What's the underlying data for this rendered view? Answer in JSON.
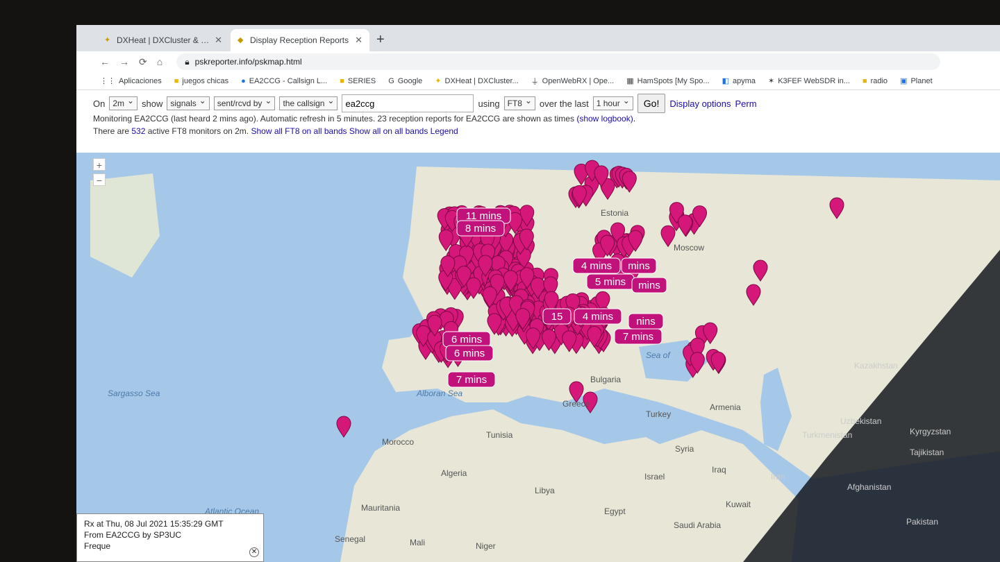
{
  "browser": {
    "tabs": [
      {
        "label": "DXHeat | DXCluster & DX Resear...",
        "icon": "dxheat-icon"
      },
      {
        "label": "Display Reception Reports",
        "icon": "pskreporter-icon"
      }
    ],
    "new_tab": "+",
    "url": "pskreporter.info/pskmap.html"
  },
  "bookmarks": [
    {
      "label": "Aplicaciones"
    },
    {
      "label": "juegos chicas"
    },
    {
      "label": "EA2CCG - Callsign L..."
    },
    {
      "label": "SERIES"
    },
    {
      "label": "Google"
    },
    {
      "label": "DXHeat | DXCluster..."
    },
    {
      "label": "OpenWebRX | Ope..."
    },
    {
      "label": "HamSpots [My Spo..."
    },
    {
      "label": "apyma"
    },
    {
      "label": "K3FEF WebSDR in..."
    },
    {
      "label": "radio"
    },
    {
      "label": "Planet"
    }
  ],
  "controls": {
    "on_label": "On",
    "band": "2m",
    "show_label": "show",
    "show_value": "signals",
    "direction": "sent/rcvd by",
    "target": "the callsign",
    "callsign": "ea2ccg",
    "using_label": "using",
    "mode": "FT8",
    "over_label": "over the last",
    "period": "1 hour",
    "go_label": "Go!",
    "display_options": "Display options",
    "permalink": "Perm",
    "status": "Monitoring EA2CCG (last heard 2 mins ago). Automatic refresh in 5 minutes. 23 reception reports for EA2CCG are shown as times",
    "show_logbook": "(show logbook).",
    "monitors_prefix": "There are",
    "monitors_count": "532",
    "monitors_suffix": "active FT8 monitors on 2m.",
    "show_all_ft8": "Show all FT8 on all bands",
    "show_all": "Show all on all bands",
    "legend": "Legend"
  },
  "map": {
    "zoom_in": "+",
    "zoom_out": "−",
    "places": [
      {
        "label": "Estonia"
      },
      {
        "label": "Moscow"
      },
      {
        "label": "Kazakhstan"
      },
      {
        "label": "Uzbekistan"
      },
      {
        "label": "Kyrgyzstan"
      },
      {
        "label": "Turkmenistan"
      },
      {
        "label": "Tajikistan"
      },
      {
        "label": "Afghanistan"
      },
      {
        "label": "Iran"
      },
      {
        "label": "Iraq"
      },
      {
        "label": "Syria"
      },
      {
        "label": "Israel"
      },
      {
        "label": "Kuwait"
      },
      {
        "label": "Saudi Arabia"
      },
      {
        "label": "Egypt"
      },
      {
        "label": "Libya"
      },
      {
        "label": "Tunisia"
      },
      {
        "label": "Algeria"
      },
      {
        "label": "Morocco"
      },
      {
        "label": "Mauritania"
      },
      {
        "label": "Mali"
      },
      {
        "label": "Niger"
      },
      {
        "label": "Senegal"
      },
      {
        "label": "Turkey"
      },
      {
        "label": "Armenia"
      },
      {
        "label": "Greece"
      },
      {
        "label": "Bulgaria"
      },
      {
        "label": "Pakistan"
      }
    ],
    "seas": [
      {
        "label": "Sargasso Sea"
      },
      {
        "label": "Atlantic Ocean"
      },
      {
        "label": "Alboran Sea"
      },
      {
        "label": "Sea of"
      }
    ],
    "time_labels": [
      "11 mins",
      "8 mins",
      "4 mins",
      "mins",
      "5 mins",
      "mins",
      "15",
      "4 mins",
      "nins",
      "7 mins",
      "6 mins",
      "6 mins",
      "7 mins"
    ],
    "info": {
      "line1": "Rx at Thu, 08 Jul 2021 15:35:29 GMT",
      "line2": "From EA2CCG by SP3UC",
      "line3": "Freque"
    },
    "colors": {
      "marker": "#d6177a",
      "marker_stroke": "#7a0a44",
      "label_bg": "#c0127a",
      "sea": "#a5c8e8",
      "land": "#e8e6d7"
    }
  }
}
